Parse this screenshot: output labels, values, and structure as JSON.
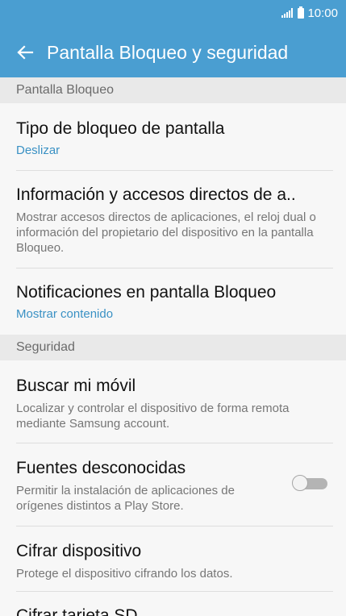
{
  "status_bar": {
    "time": "10:00"
  },
  "app_bar": {
    "title": "Pantalla Bloqueo y seguridad"
  },
  "sections": {
    "lock_screen": "Pantalla Bloqueo",
    "security": "Seguridad"
  },
  "items": {
    "lock_type": {
      "title": "Tipo de bloqueo de pantalla",
      "sub": "Deslizar"
    },
    "info_shortcuts": {
      "title": "Información y accesos directos de a..",
      "desc": "Mostrar accesos directos de aplicaciones, el reloj dual o información del propietario del dispositivo en la pantalla Bloqueo."
    },
    "lock_notifications": {
      "title": "Notificaciones en pantalla Bloqueo",
      "sub": "Mostrar contenido"
    },
    "find_mobile": {
      "title": "Buscar mi móvil",
      "desc": "Localizar y controlar el dispositivo de forma remota mediante Samsung account."
    },
    "unknown_sources": {
      "title": "Fuentes desconocidas",
      "desc": "Permitir la instalación de aplicaciones de orígenes distintos a Play Store.",
      "enabled": false
    },
    "encrypt_device": {
      "title": "Cifrar dispositivo",
      "desc": "Protege el dispositivo cifrando los datos."
    },
    "encrypt_sd": {
      "title": "Cifrar tarjeta SD"
    }
  },
  "colors": {
    "app_bar": "#4a9ed1",
    "accent_text": "#3a91c4",
    "section_header_bg": "#e9e9e9",
    "background": "#f7f7f7"
  },
  "icons": {
    "back": "arrow-left-icon",
    "signal": "signal-icon",
    "battery": "battery-icon"
  }
}
